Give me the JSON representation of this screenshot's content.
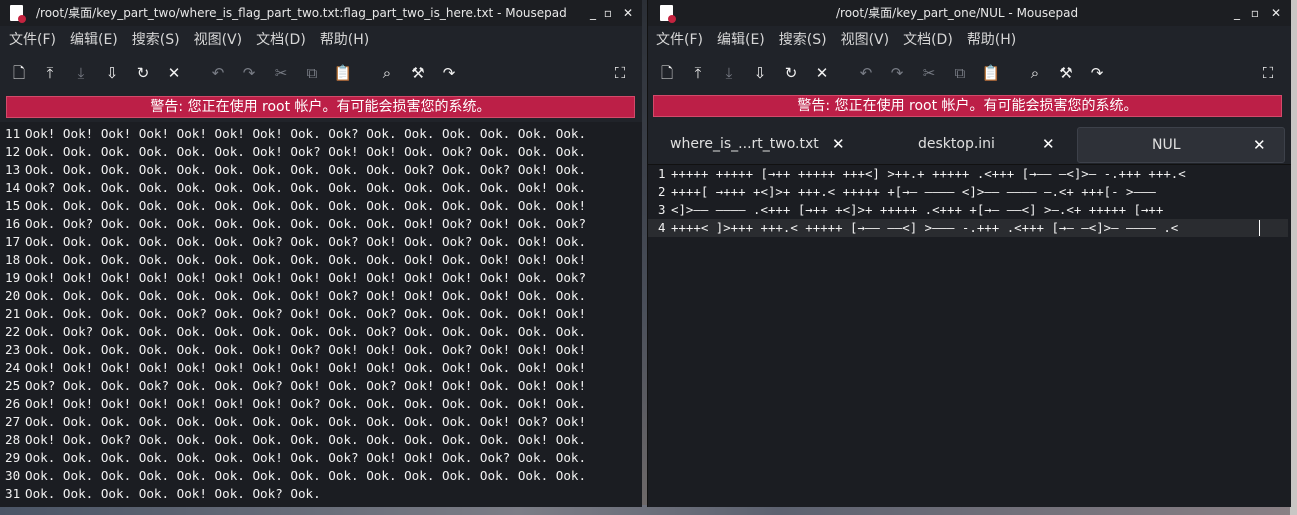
{
  "left": {
    "title": "/root/桌面/key_part_two/where_is_flag_part_two.txt:flag_part_two_is_here.txt - Mousepad",
    "menu": [
      "文件(F)",
      "编辑(E)",
      "搜索(S)",
      "视图(V)",
      "文档(D)",
      "帮助(H)"
    ],
    "warning": "警告: 您正在使用 root 帐户。有可能会损害您的系统。",
    "lines": [
      {
        "n": "11",
        "t": "Ook! Ook! Ook! Ook! Ook! Ook! Ook! Ook. Ook? Ook. Ook. Ook. Ook. Ook. Ook."
      },
      {
        "n": "12",
        "t": "Ook. Ook. Ook. Ook. Ook. Ook. Ook! Ook? Ook! Ook! Ook. Ook? Ook. Ook. Ook."
      },
      {
        "n": "13",
        "t": "Ook. Ook. Ook. Ook. Ook. Ook. Ook. Ook. Ook. Ook. Ook? Ook. Ook? Ook! Ook."
      },
      {
        "n": "14",
        "t": "Ook? Ook. Ook. Ook. Ook. Ook. Ook. Ook. Ook. Ook. Ook. Ook. Ook. Ook! Ook."
      },
      {
        "n": "15",
        "t": "Ook. Ook. Ook. Ook. Ook. Ook. Ook. Ook. Ook. Ook. Ook. Ook. Ook. Ook. Ook!"
      },
      {
        "n": "16",
        "t": "Ook. Ook? Ook. Ook. Ook. Ook. Ook. Ook. Ook. Ook. Ook! Ook? Ook! Ook. Ook?"
      },
      {
        "n": "17",
        "t": "Ook. Ook. Ook. Ook. Ook. Ook. Ook? Ook. Ook? Ook! Ook. Ook? Ook. Ook! Ook."
      },
      {
        "n": "18",
        "t": "Ook. Ook. Ook. Ook. Ook. Ook. Ook. Ook. Ook. Ook. Ook! Ook. Ook! Ook! Ook!"
      },
      {
        "n": "19",
        "t": "Ook! Ook! Ook! Ook! Ook! Ook! Ook! Ook! Ook! Ook! Ook! Ook! Ook! Ook. Ook?"
      },
      {
        "n": "20",
        "t": "Ook. Ook. Ook. Ook. Ook. Ook. Ook. Ook! Ook? Ook! Ook! Ook. Ook! Ook. Ook."
      },
      {
        "n": "21",
        "t": "Ook. Ook. Ook. Ook. Ook? Ook. Ook? Ook! Ook. Ook? Ook. Ook. Ook. Ook! Ook!"
      },
      {
        "n": "22",
        "t": "Ook. Ook? Ook. Ook. Ook. Ook. Ook. Ook. Ook. Ook? Ook. Ook. Ook. Ook. Ook."
      },
      {
        "n": "23",
        "t": "Ook. Ook. Ook. Ook. Ook. Ook. Ook! Ook? Ook! Ook! Ook. Ook? Ook! Ook! Ook!"
      },
      {
        "n": "24",
        "t": "Ook! Ook! Ook! Ook! Ook! Ook! Ook! Ook! Ook! Ook! Ook. Ook! Ook. Ook! Ook!"
      },
      {
        "n": "25",
        "t": "Ook? Ook. Ook. Ook? Ook. Ook. Ook? Ook! Ook. Ook? Ook! Ook! Ook. Ook! Ook!"
      },
      {
        "n": "26",
        "t": "Ook! Ook! Ook! Ook! Ook! Ook! Ook! Ook? Ook. Ook. Ook. Ook. Ook. Ook! Ook."
      },
      {
        "n": "27",
        "t": "Ook. Ook. Ook. Ook. Ook. Ook. Ook. Ook. Ook. Ook. Ook. Ook. Ook! Ook? Ook!"
      },
      {
        "n": "28",
        "t": "Ook! Ook. Ook? Ook. Ook. Ook. Ook. Ook. Ook. Ook. Ook. Ook. Ook. Ook! Ook."
      },
      {
        "n": "29",
        "t": "Ook. Ook. Ook. Ook. Ook. Ook. Ook! Ook. Ook? Ook! Ook! Ook. Ook? Ook. Ook."
      },
      {
        "n": "30",
        "t": "Ook. Ook. Ook. Ook. Ook. Ook. Ook. Ook. Ook. Ook. Ook. Ook. Ook. Ook. Ook."
      },
      {
        "n": "31",
        "t": "Ook. Ook. Ook. Ook. Ook! Ook. Ook? Ook."
      }
    ]
  },
  "right": {
    "title": "/root/桌面/key_part_one/NUL - Mousepad",
    "menu": [
      "文件(F)",
      "编辑(E)",
      "搜索(S)",
      "视图(V)",
      "文档(D)",
      "帮助(H)"
    ],
    "warning": "警告: 您正在使用 root 帐户。有可能会损害您的系统。",
    "tabs": [
      {
        "label": "where_is_...rt_two.txt",
        "active": false
      },
      {
        "label": "desktop.ini",
        "active": false
      },
      {
        "label": "NUL",
        "active": true
      }
    ],
    "lines": [
      {
        "n": "1",
        "t": "+++++ +++++ [→++ +++++ +++<] >++.+ +++++ .<+++ [→—— —<]>— -.+++ +++.<"
      },
      {
        "n": "2",
        "t": "++++[ →+++ +<]>+ +++.< +++++ +[→— ———— <]>—— ———— —.<+ +++[- >———"
      },
      {
        "n": "3",
        "t": "<]>—— ———— .<+++ [→++ +<]>+ +++++ .<+++ +[→— ——<] >—.<+ +++++ [→++"
      },
      {
        "n": "4",
        "t": "++++< ]>+++ +++.< +++++ [→—— ——<] >——— -.+++ .<+++ [→— —<]>— ———— .<"
      }
    ]
  }
}
